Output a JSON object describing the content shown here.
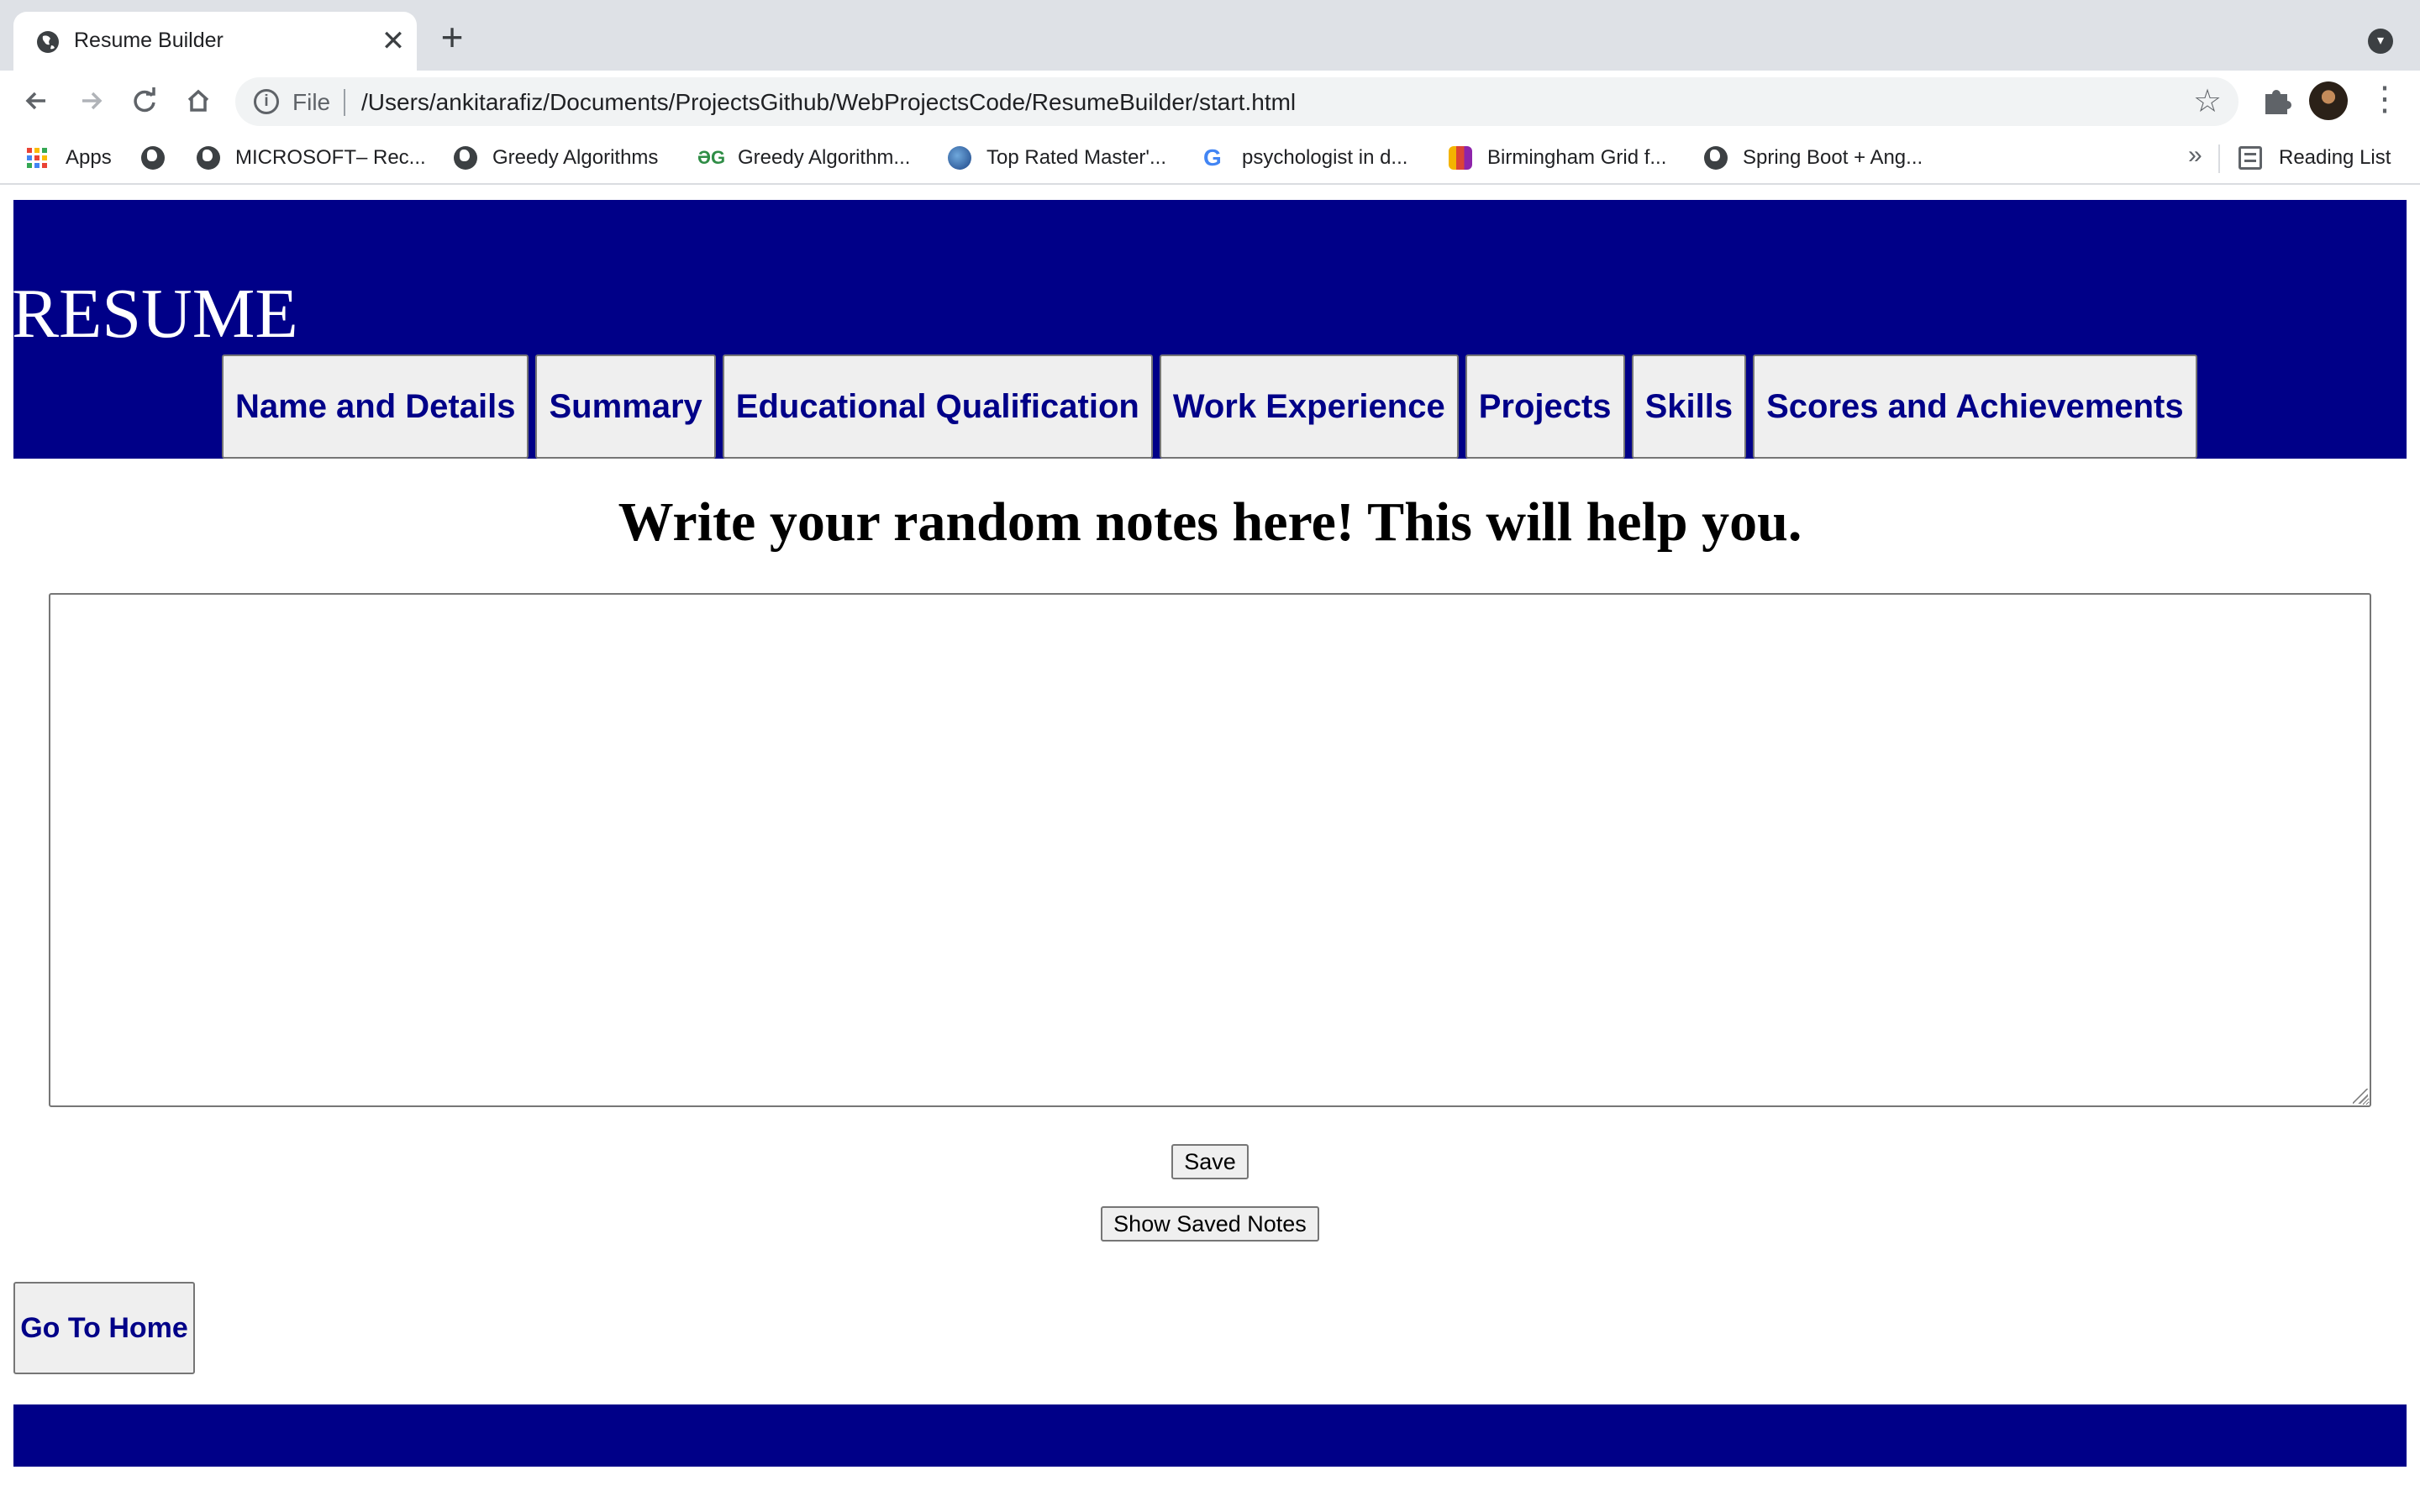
{
  "browser": {
    "tab_title": "Resume Builder",
    "tab_close": "✕",
    "new_tab": "+",
    "omnibox": {
      "scheme_label": "File",
      "url": "/Users/ankitarafiz/Documents/ProjectsGithub/WebProjectsCode/ResumeBuilder/start.html"
    },
    "bookmarks": [
      {
        "label": "Apps",
        "icon": "apps-grid-icon"
      },
      {
        "label": "",
        "icon": "globe-icon"
      },
      {
        "label": "MICROSOFT– Rec...",
        "icon": "globe-icon"
      },
      {
        "label": "Greedy Algorithms",
        "icon": "globe-icon"
      },
      {
        "label": "Greedy Algorithm...",
        "icon": "geeksforgeeks-icon"
      },
      {
        "label": "Top Rated Master'...",
        "icon": "globe-color-icon"
      },
      {
        "label": "psychologist in d...",
        "icon": "google-icon"
      },
      {
        "label": "Birmingham Grid f...",
        "icon": "colorful-app-icon"
      },
      {
        "label": "Spring Boot + Ang...",
        "icon": "globe-icon"
      }
    ],
    "bookmarks_more": "»",
    "reading_list": "Reading List"
  },
  "header": {
    "title": "RESUME",
    "nav": [
      {
        "label": "Name and Details"
      },
      {
        "label": "Summary"
      },
      {
        "label": "Educational Qualification"
      },
      {
        "label": "Work Experience"
      },
      {
        "label": "Projects"
      },
      {
        "label": "Skills"
      },
      {
        "label": "Scores and Achievements"
      }
    ]
  },
  "notes": {
    "heading": "Write your random notes here! This will help you.",
    "value": "",
    "save_label": "Save",
    "show_label": "Show Saved Notes"
  },
  "home_label": "Go To Home",
  "colors": {
    "brand_navy": "#000088",
    "button_bg": "#efefef"
  }
}
